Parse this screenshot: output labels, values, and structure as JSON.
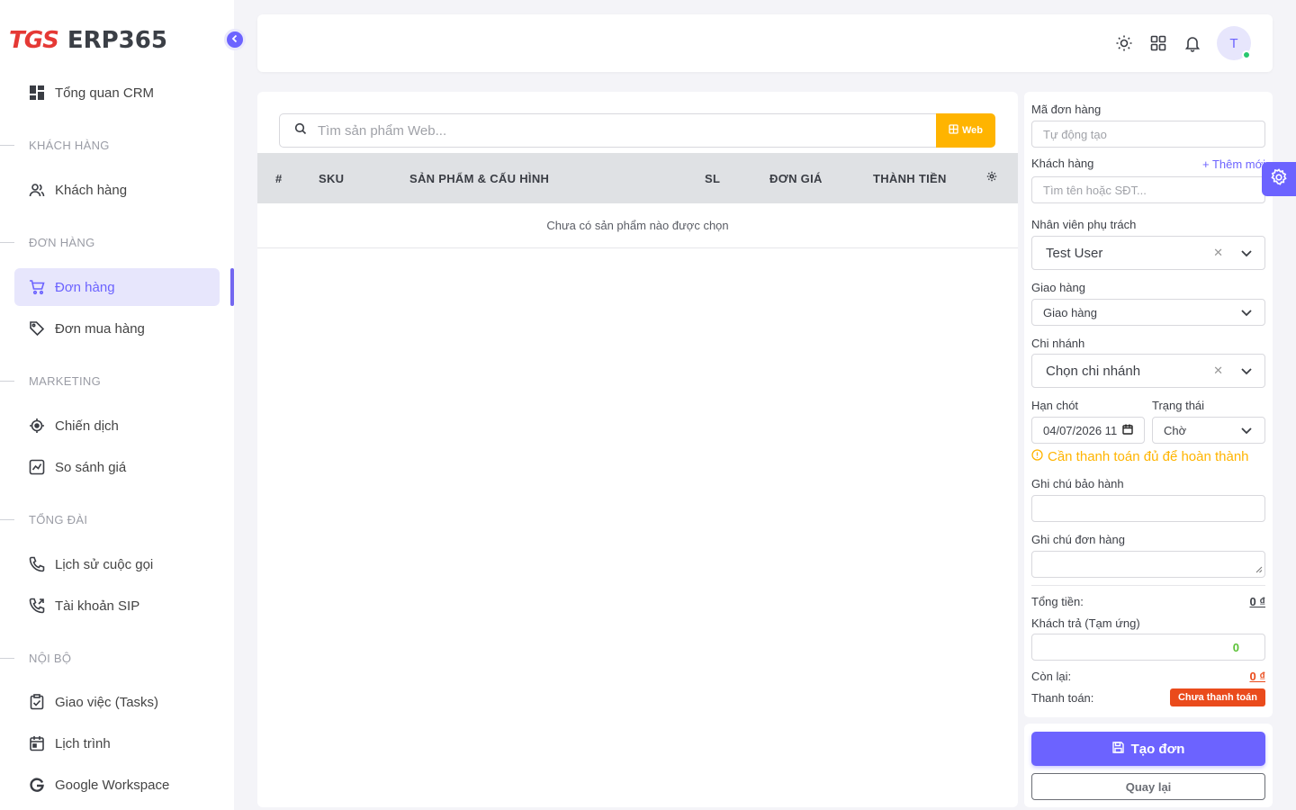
{
  "brand": {
    "logo": "TGS",
    "name": "ERP365"
  },
  "sidebar": {
    "items": [
      {
        "label": "Tổng quan CRM"
      },
      {
        "label": "Khách hàng"
      },
      {
        "label": "Đơn hàng"
      },
      {
        "label": "Đơn mua hàng"
      },
      {
        "label": "Chiến dịch"
      },
      {
        "label": "So sánh giá"
      },
      {
        "label": "Lịch sử cuộc gọi"
      },
      {
        "label": "Tài khoản SIP"
      },
      {
        "label": "Giao việc (Tasks)"
      },
      {
        "label": "Lịch trình"
      },
      {
        "label": "Google Workspace"
      }
    ],
    "sections": [
      "KHÁCH HÀNG",
      "ĐƠN HÀNG",
      "MARKETING",
      "TỔNG ĐÀI",
      "NỘI BỘ"
    ]
  },
  "topbar": {
    "avatar_initial": "T"
  },
  "product_search": {
    "placeholder": "Tìm sản phẩm Web...",
    "web_label": "Web"
  },
  "table": {
    "headers": [
      "#",
      "SKU",
      "SẢN PHẨM & CẤU HÌNH",
      "SL",
      "ĐƠN GIÁ",
      "THÀNH TIỀN"
    ],
    "empty_text": "Chưa có sản phẩm nào được chọn"
  },
  "form": {
    "order_code": {
      "label": "Mã đơn hàng",
      "placeholder": "Tự động tạo"
    },
    "customer": {
      "label": "Khách hàng",
      "add_new": "+ Thêm mới",
      "placeholder": "Tìm tên hoặc SĐT..."
    },
    "staff": {
      "label": "Nhân viên phụ trách",
      "value": "Test User"
    },
    "delivery": {
      "label": "Giao hàng",
      "value": "Giao hàng"
    },
    "branch": {
      "label": "Chi nhánh",
      "value": "Chọn chi nhánh"
    },
    "deadline": {
      "label": "Hạn chót",
      "value": "04/07/2026 11"
    },
    "status": {
      "label": "Trạng thái",
      "value": "Chờ"
    },
    "warning": "Cần thanh toán đủ để hoàn thành",
    "warranty_note": {
      "label": "Ghi chú bảo hành"
    },
    "order_note": {
      "label": "Ghi chú đơn hàng"
    }
  },
  "summary": {
    "total_label": "Tổng tiền:",
    "total_value": "0 ₫",
    "paid_label": "Khách trả (Tạm ứng)",
    "paid_value": "0",
    "remaining_label": "Còn lại:",
    "remaining_value": "0 ₫",
    "payment_label": "Thanh toán:",
    "payment_status": "Chưa thanh toán"
  },
  "actions": {
    "create": "Tạo đơn",
    "back": "Quay lại"
  },
  "colors": {
    "accent": "#6c63ff",
    "warning": "#ffb400",
    "danger": "#ea4b1c",
    "success": "#28c76f",
    "brand_red": "#e53935"
  }
}
